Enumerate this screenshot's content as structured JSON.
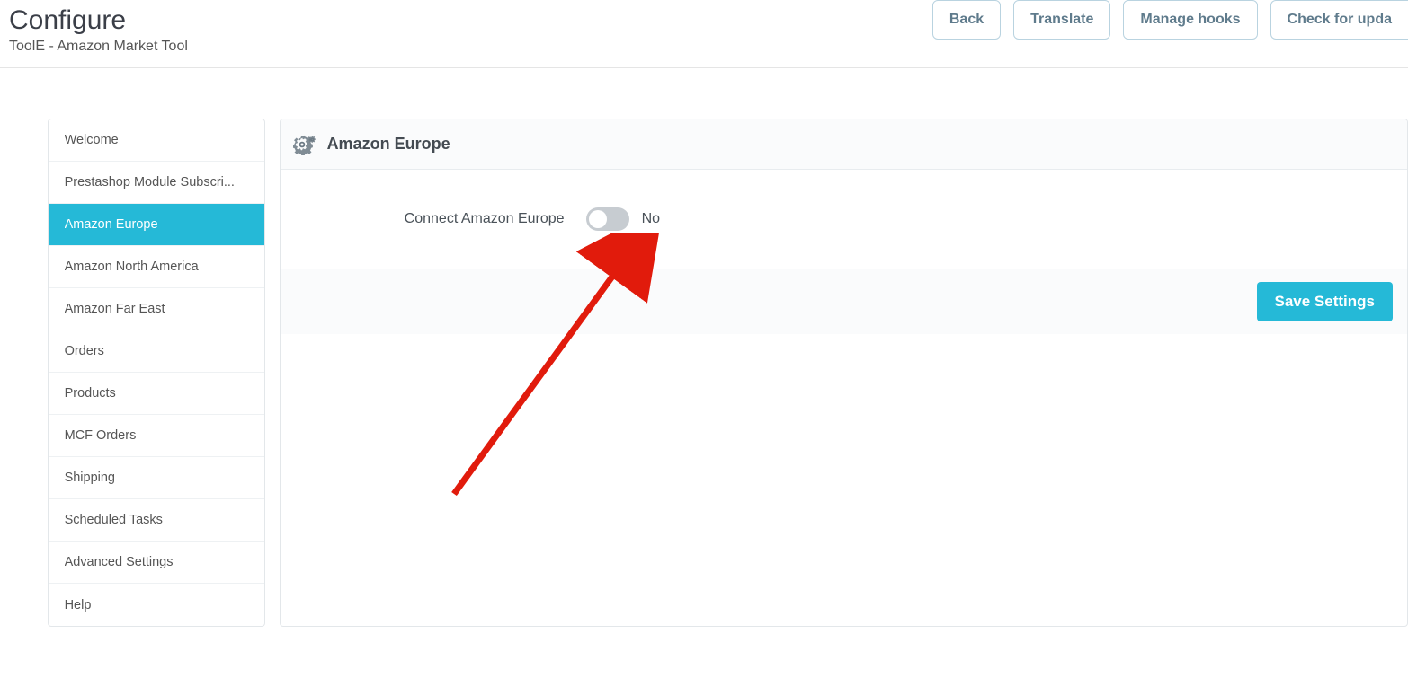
{
  "header": {
    "title": "Configure",
    "subtitle": "ToolE - Amazon Market Tool",
    "buttons": {
      "back": "Back",
      "translate": "Translate",
      "manage_hooks": "Manage hooks",
      "check_updates": "Check for upda"
    }
  },
  "sidebar": {
    "items": [
      {
        "label": "Welcome",
        "active": false
      },
      {
        "label": "Prestashop Module Subscri...",
        "active": false
      },
      {
        "label": "Amazon Europe",
        "active": true
      },
      {
        "label": "Amazon North America",
        "active": false
      },
      {
        "label": "Amazon Far East",
        "active": false
      },
      {
        "label": "Orders",
        "active": false
      },
      {
        "label": "Products",
        "active": false
      },
      {
        "label": "MCF Orders",
        "active": false
      },
      {
        "label": "Shipping",
        "active": false
      },
      {
        "label": "Scheduled Tasks",
        "active": false
      },
      {
        "label": "Advanced Settings",
        "active": false
      },
      {
        "label": "Help",
        "active": false
      }
    ]
  },
  "panel": {
    "title": "Amazon Europe",
    "field_label": "Connect Amazon Europe",
    "toggle_value_label": "No",
    "save_label": "Save Settings"
  },
  "colors": {
    "accent": "#25b9d7",
    "annotation": "#e11b0c"
  }
}
